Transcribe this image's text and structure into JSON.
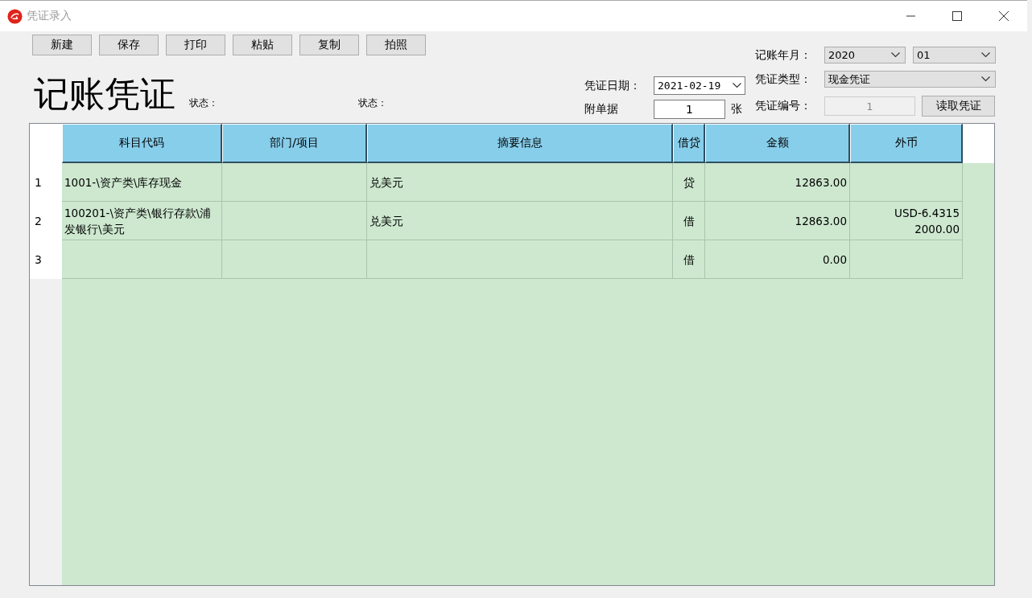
{
  "window": {
    "title": "凭证录入"
  },
  "toolbar": [
    "新建",
    "保存",
    "打印",
    "粘贴",
    "复制",
    "拍照"
  ],
  "heading": "记账凭证",
  "status_labels": [
    "状态：",
    "状态："
  ],
  "voucher_date": {
    "label": "凭证日期：",
    "value": "2021-02-19"
  },
  "attachments": {
    "label": "附单据",
    "value": "1",
    "unit": "张"
  },
  "period": {
    "label": "记账年月：",
    "year": "2020",
    "month": "01"
  },
  "voucher_type": {
    "label": "凭证类型：",
    "value": "现金凭证"
  },
  "voucher_number": {
    "label": "凭证编号：",
    "value": "1",
    "disabled": true
  },
  "read_button": "读取凭证",
  "table": {
    "columns": [
      "科目代码",
      "部门/项目",
      "摘要信息",
      "借贷",
      "金额",
      "外币"
    ],
    "rows": [
      {
        "number": "1",
        "cells": [
          "1001-\\资产类\\库存现金",
          "",
          "兑美元",
          "贷",
          "12863.00",
          ""
        ]
      },
      {
        "number": "2",
        "cells": [
          "100201-\\资产类\\银行存款\\浦发银行\\美元",
          "",
          "兑美元",
          "借",
          "12863.00",
          "USD-6.4315\n2000.00"
        ]
      },
      {
        "number": "3",
        "cells": [
          "",
          "",
          "",
          "借",
          "0.00",
          ""
        ]
      }
    ]
  }
}
